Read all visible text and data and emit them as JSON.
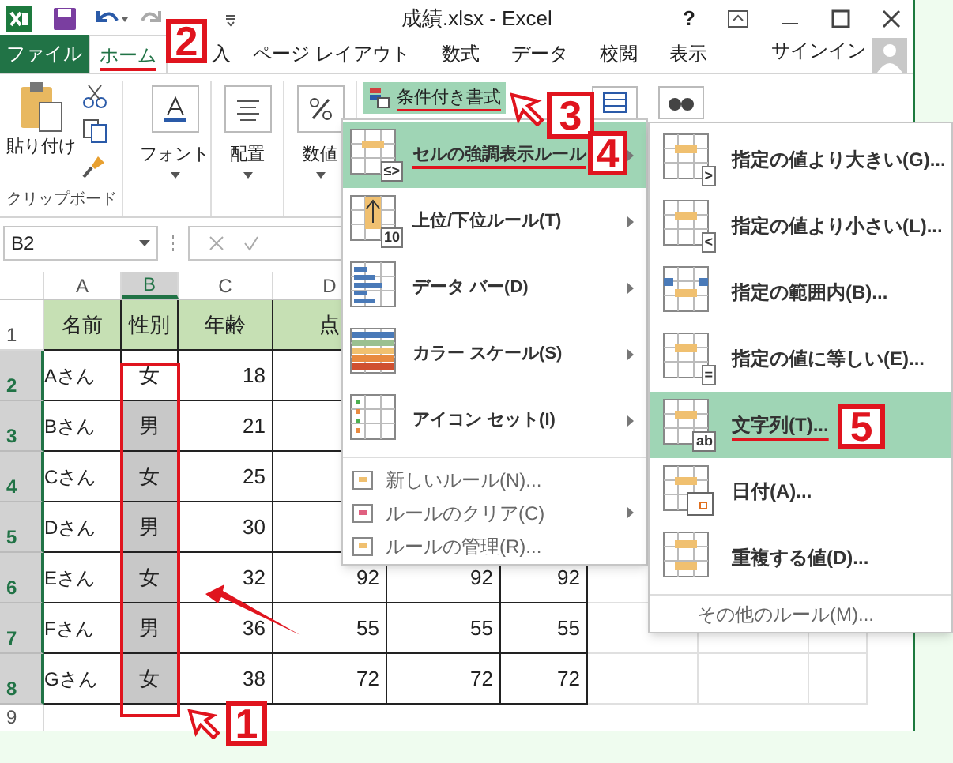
{
  "title_bar": {
    "title": "成績.xlsx - Excel",
    "help": "?"
  },
  "tabs": [
    {
      "label": "ファイル",
      "kind": "file",
      "selected": false
    },
    {
      "label": "ホーム",
      "kind": "tab",
      "selected": true
    },
    {
      "label": "入",
      "kind": "tab",
      "selected": false
    },
    {
      "label": "ページ レイアウト",
      "kind": "tab",
      "selected": false
    },
    {
      "label": "数式",
      "kind": "tab",
      "selected": false
    },
    {
      "label": "データ",
      "kind": "tab",
      "selected": false
    },
    {
      "label": "校閲",
      "kind": "tab",
      "selected": false
    },
    {
      "label": "表示",
      "kind": "tab",
      "selected": false
    }
  ],
  "sign_in": "サインイン",
  "ribbon": {
    "paste": "貼り付け",
    "clipboard_group": "クリップボード",
    "font": "フォント",
    "alignment": "配置",
    "number": "数値",
    "conditional_formatting": {
      "label": "条件付き書式",
      "selected": true
    }
  },
  "name_box": "B2",
  "columns": [
    {
      "label": "A",
      "selected": false
    },
    {
      "label": "B",
      "selected": true
    },
    {
      "label": "C",
      "selected": false
    },
    {
      "label": "D",
      "selected": false
    }
  ],
  "header_row": {
    "number": "1",
    "name": "名前",
    "gender": "性別",
    "age": "年齢",
    "score": "点"
  },
  "rows": [
    {
      "number": "2",
      "name": "Aさん",
      "gender": "女",
      "age": "18",
      "active": true,
      "scores": []
    },
    {
      "number": "3",
      "name": "Bさん",
      "gender": "男",
      "age": "21",
      "active": false,
      "scores": []
    },
    {
      "number": "4",
      "name": "Cさん",
      "gender": "女",
      "age": "25",
      "active": false,
      "scores": []
    },
    {
      "number": "5",
      "name": "Dさん",
      "gender": "男",
      "age": "30",
      "active": false,
      "scores": []
    },
    {
      "number": "6",
      "name": "Eさん",
      "gender": "女",
      "age": "32",
      "active": false,
      "scores": [
        "92",
        "92",
        "92"
      ]
    },
    {
      "number": "7",
      "name": "Fさん",
      "gender": "男",
      "age": "36",
      "active": false,
      "scores": [
        "55",
        "55",
        "55"
      ]
    },
    {
      "number": "8",
      "name": "Gさん",
      "gender": "女",
      "age": "38",
      "active": false,
      "scores": [
        "72",
        "72",
        "72"
      ]
    }
  ],
  "empty_row": "9",
  "menu": {
    "items": [
      {
        "kind": "large",
        "badge": "≤>",
        "label": "セルの強調表示ルール",
        "submenu": true,
        "selected": true
      },
      {
        "kind": "large",
        "badge": "10",
        "label": "上位/下位ルール(T)",
        "submenu": true,
        "selected": false
      },
      {
        "kind": "large",
        "label": "データ バー(D)",
        "submenu": true,
        "selected": false
      },
      {
        "kind": "large",
        "label": "カラー スケール(S)",
        "submenu": true,
        "selected": false
      },
      {
        "kind": "large",
        "label": "アイコン セット(I)",
        "submenu": true,
        "selected": false
      },
      {
        "kind": "small",
        "label": "新しいルール(N)...",
        "submenu": false,
        "selected": false
      },
      {
        "kind": "small",
        "label": "ルールのクリア(C)",
        "submenu": true,
        "selected": false
      },
      {
        "kind": "small",
        "label": "ルールの管理(R)...",
        "submenu": false,
        "selected": false
      }
    ]
  },
  "submenu": {
    "items": [
      {
        "badge": ">",
        "label": "指定の値より大きい(G)...",
        "selected": false
      },
      {
        "badge": "<",
        "label": "指定の値より小さい(L)...",
        "selected": false
      },
      {
        "label": "指定の範囲内(B)...",
        "selected": false
      },
      {
        "badge": "=",
        "label": "指定の値に等しい(E)...",
        "selected": false
      },
      {
        "badge": "ab",
        "label": "文字列(T)...",
        "selected": true
      },
      {
        "label": "日付(A)...",
        "selected": false
      },
      {
        "label": "重複する値(D)...",
        "selected": false
      }
    ],
    "more": "その他のルール(M)..."
  },
  "annotations": [
    {
      "label": "1"
    },
    {
      "label": "2"
    },
    {
      "label": "3"
    },
    {
      "label": "4"
    },
    {
      "label": "5"
    }
  ]
}
